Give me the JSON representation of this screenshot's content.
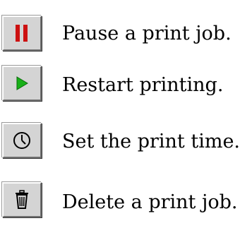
{
  "actions": [
    {
      "icon": "pause-icon",
      "label": "Pause a print job.",
      "icon_color": "#cc1111"
    },
    {
      "icon": "play-icon",
      "label": "Restart printing.",
      "icon_color": "#18b018"
    },
    {
      "icon": "clock-icon",
      "label": "Set the print time.",
      "icon_color": "#000000"
    },
    {
      "icon": "trash-icon",
      "label": "Delete a print job.",
      "icon_color": "#000000"
    }
  ]
}
